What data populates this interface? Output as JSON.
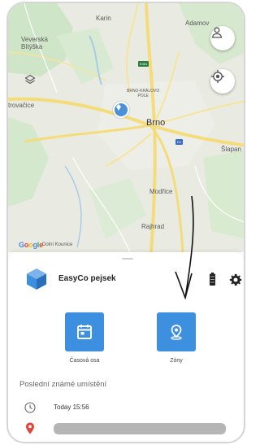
{
  "map": {
    "labels": {
      "karin": "Karin",
      "adamov": "Adamov",
      "veverska_bityska": "Veverská\nBítýška",
      "rozdrojovice": "trovačice",
      "brno": "Brno",
      "modrice": "Modřice",
      "rajhrad": "Rajhrad",
      "slapanice": "Šlapan",
      "brno_kralovo_pole": "BRNO-KRÁLOVO\nPOLE",
      "dolni_kounice": "Dolní Kounice"
    },
    "road_badges": {
      "e461": "E461",
      "d1": "D1"
    },
    "attribution": "Google",
    "colors": {
      "land": "#e9ebe2",
      "roads": "#f7e79b",
      "marker": "#4a90d9"
    }
  },
  "sheet": {
    "device_name": "EasyCo pejsek",
    "actions": {
      "timeline_label": "Časová osa",
      "zones_label": "Zóny"
    },
    "last_location_title": "Poslední známé umístění",
    "last_seen": "Today 15:56",
    "accent_color": "#3d8fe0"
  },
  "icons": {
    "profile": "person-icon",
    "locate": "gps-target-icon",
    "layers": "layers-icon",
    "device": "cube-icon",
    "battery": "battery-icon",
    "settings": "gear-icon",
    "calendar": "calendar-icon",
    "zones": "map-pin-icon",
    "clock": "clock-icon",
    "location": "location-pin-icon"
  }
}
